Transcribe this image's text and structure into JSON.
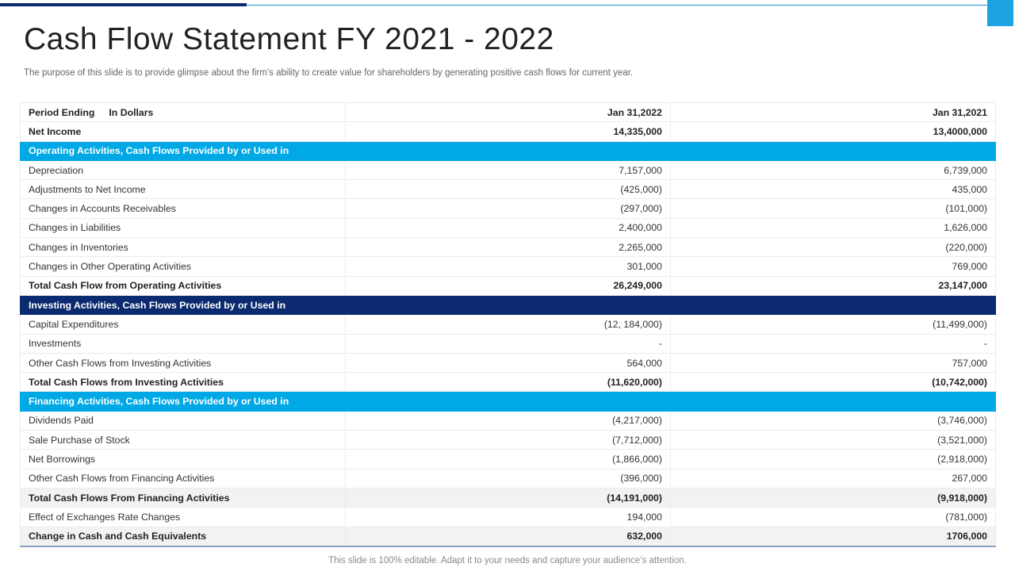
{
  "title": "Cash Flow Statement FY 2021 - 2022",
  "subtitle": "The purpose of this slide is to provide glimpse about the firm’s ability to create value for shareholders by generating positive cash flows for current year.",
  "colors": {
    "accent_light": "#00a9e6",
    "accent_dark": "#0b2a6f"
  },
  "table": {
    "header": {
      "period": "Period Ending",
      "unit": "In Dollars",
      "col1": "Jan 31,2022",
      "col2": "Jan 31,2021"
    },
    "net_income": {
      "label": "Net Income",
      "v1": "14,335,000",
      "v2": "13,4000,000"
    },
    "operating": {
      "heading": "Operating Activities, Cash Flows Provided by or Used in",
      "rows": [
        {
          "label": "Depreciation",
          "v1": "7,157,000",
          "v2": "6,739,000"
        },
        {
          "label": "Adjustments to Net Income",
          "v1": "(425,000)",
          "v2": "435,000"
        },
        {
          "label": "Changes in Accounts Receivables",
          "v1": "(297,000)",
          "v2": "(101,000)"
        },
        {
          "label": "Changes in Liabilities",
          "v1": "2,400,000",
          "v2": "1,626,000"
        },
        {
          "label": "Changes in Inventories",
          "v1": "2,265,000",
          "v2": "(220,000)"
        },
        {
          "label": "Changes in Other Operating Activities",
          "v1": "301,000",
          "v2": "769,000"
        }
      ],
      "total": {
        "label": "Total Cash Flow from Operating Activities",
        "v1": "26,249,000",
        "v2": "23,147,000"
      }
    },
    "investing": {
      "heading": "Investing Activities, Cash Flows Provided by or Used in",
      "rows": [
        {
          "label": "Capital Expenditures",
          "v1": "(12, 184,000)",
          "v2": "(11,499,000)"
        },
        {
          "label": "Investments",
          "v1": "-",
          "v2": "-"
        },
        {
          "label": "Other Cash Flows from Investing Activities",
          "v1": "564,000",
          "v2": "757,000"
        }
      ],
      "total": {
        "label": "Total Cash Flows from Investing  Activities",
        "v1": "(11,620,000)",
        "v2": "(10,742,000)"
      }
    },
    "financing": {
      "heading": "Financing Activities, Cash Flows Provided by or Used in",
      "rows": [
        {
          "label": "Dividends Paid",
          "v1": "(4,217,000)",
          "v2": "(3,746,000)"
        },
        {
          "label": "Sale Purchase of Stock",
          "v1": "(7,712,000)",
          "v2": "(3,521,000)"
        },
        {
          "label": "Net Borrowings",
          "v1": "(1,866,000)",
          "v2": "(2,918,000)"
        },
        {
          "label": "Other Cash Flows from Financing Activities",
          "v1": "(396,000)",
          "v2": "267,000"
        }
      ],
      "total": {
        "label": "Total Cash Flows From Financing  Activities",
        "v1": "(14,191,000)",
        "v2": "(9,918,000)"
      }
    },
    "exchange": {
      "label": "Effect of Exchanges Rate Changes",
      "v1": "194,000",
      "v2": "(781,000)"
    },
    "change": {
      "label": "Change in Cash and Cash Equivalents",
      "v1": "632,000",
      "v2": "1706,000"
    }
  },
  "footer": "This slide is 100% editable. Adapt it to your needs and capture your audience’s attention."
}
